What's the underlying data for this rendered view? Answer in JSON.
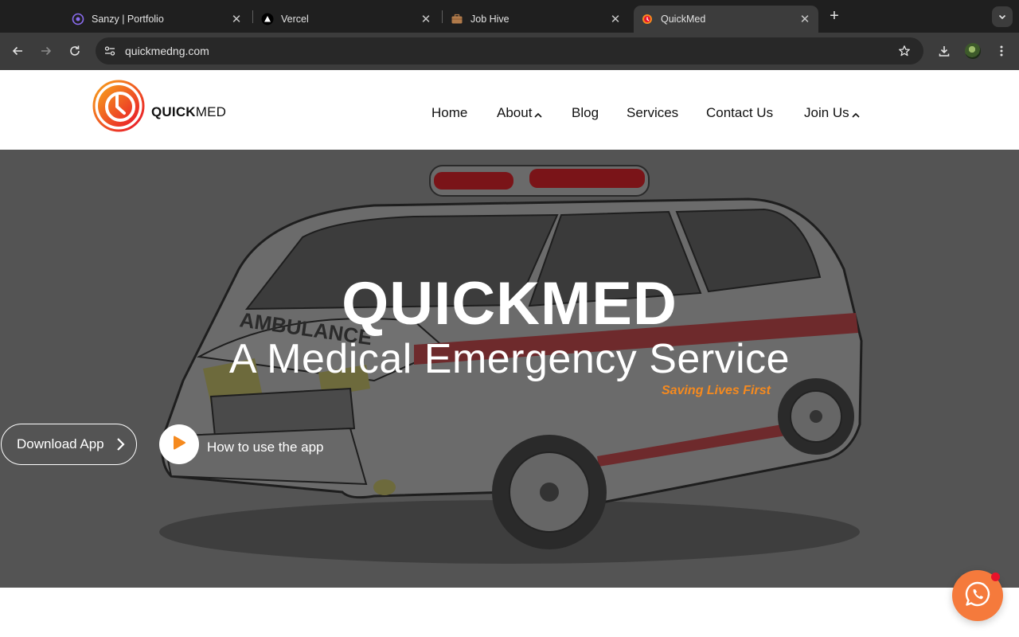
{
  "browser": {
    "tabs": [
      {
        "title": "Sanzy | Portfolio",
        "active": false
      },
      {
        "title": "Vercel",
        "active": false
      },
      {
        "title": "Job Hive",
        "active": false
      },
      {
        "title": "QuickMed",
        "active": true
      }
    ],
    "url": "quickmedng.com"
  },
  "site": {
    "brand_bold": "QUICK",
    "brand_light": "MED",
    "nav": {
      "home": "Home",
      "about": "About",
      "blog": "Blog",
      "services": "Services",
      "contact": "Contact Us",
      "join": "Join Us"
    },
    "hero": {
      "title": "QUICKMED",
      "subtitle": "A Medical Emergency Service",
      "tagline": "Saving Lives First",
      "download_label": "Download App",
      "howto_label": "How to use the app",
      "vehicle_text": "AMBULANCE"
    },
    "colors": {
      "accent": "#f58a1f",
      "logo_red": "#e8132b",
      "fab": "#f57a3c"
    },
    "icons": {
      "chat": "whatsapp-icon",
      "play": "play-icon"
    }
  }
}
